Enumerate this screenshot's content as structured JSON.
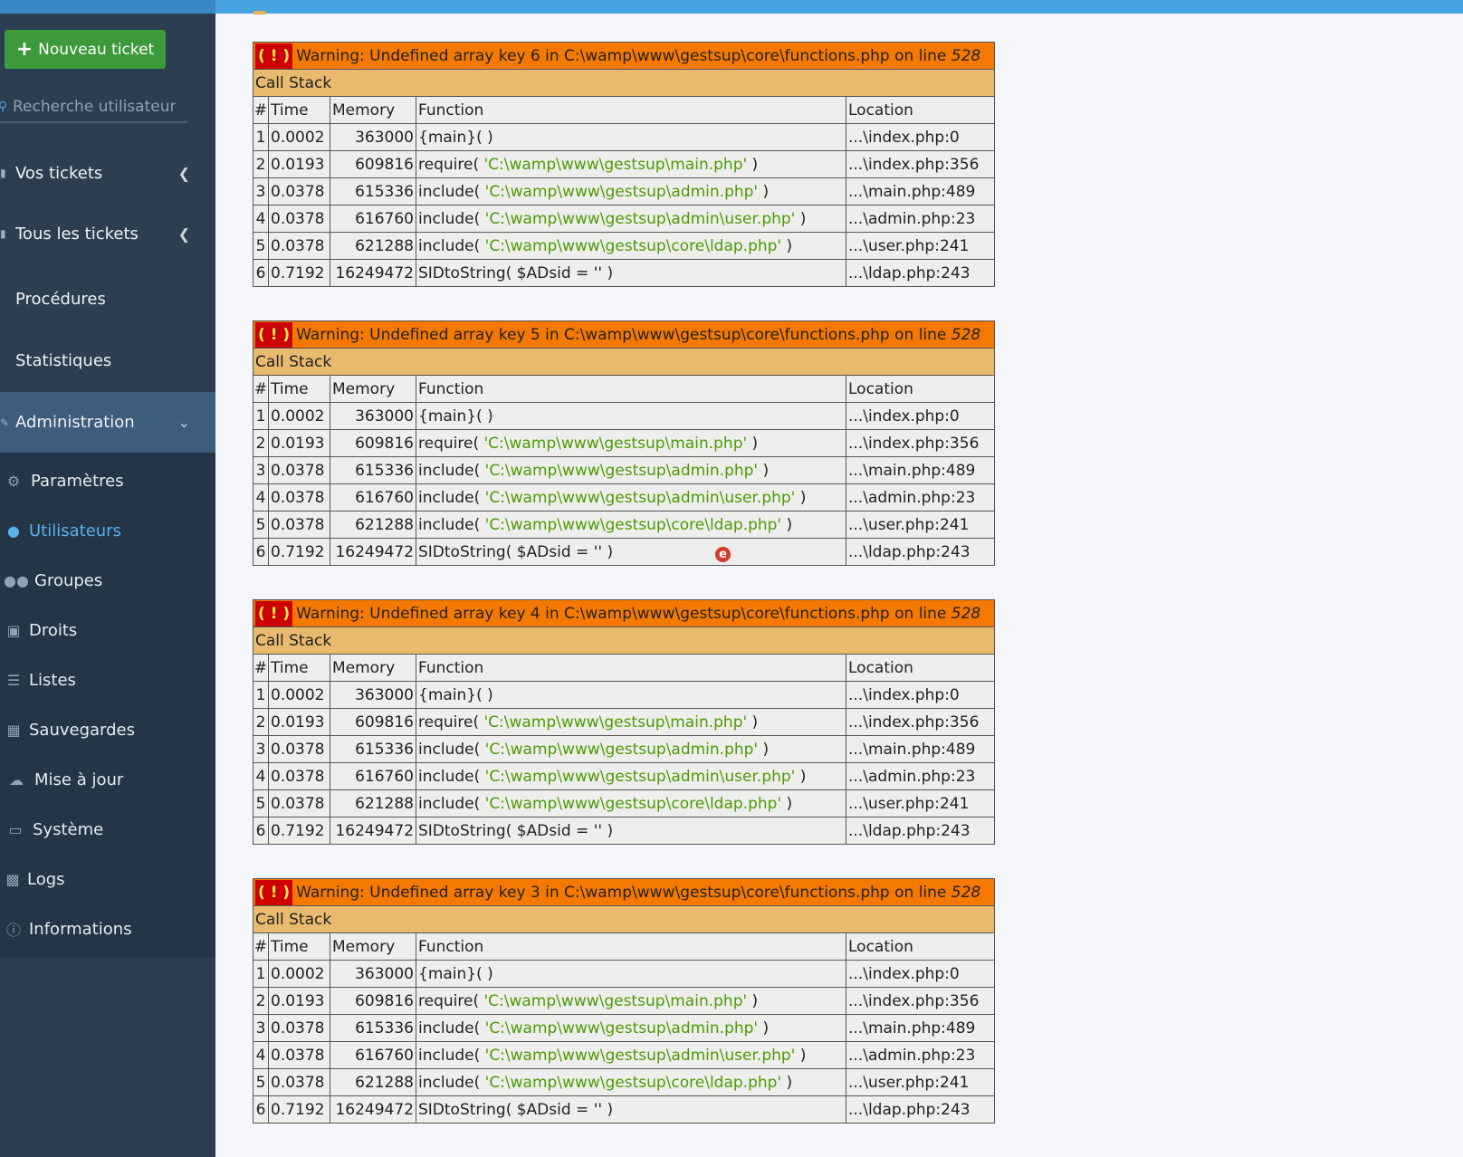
{
  "sidebar": {
    "new_ticket_label": "Nouveau ticket",
    "search_placeholder": "Recherche utilisateur",
    "nav": [
      {
        "label": "Vos tickets"
      },
      {
        "label": "Tous les tickets"
      },
      {
        "label": "Procédures"
      },
      {
        "label": "Statistiques"
      },
      {
        "label": "Administration"
      }
    ],
    "admin_items": [
      {
        "label": "Paramètres",
        "icon": "gear-icon"
      },
      {
        "label": "Utilisateurs",
        "icon": "user-icon"
      },
      {
        "label": "Groupes",
        "icon": "users-icon"
      },
      {
        "label": "Droits",
        "icon": "lock-icon"
      },
      {
        "label": "Listes",
        "icon": "list-icon"
      },
      {
        "label": "Sauvegardes",
        "icon": "save-icon"
      },
      {
        "label": "Mise à jour",
        "icon": "cloud-upload-icon"
      },
      {
        "label": "Système",
        "icon": "monitor-icon"
      },
      {
        "label": "Logs",
        "icon": "clipboard-icon"
      },
      {
        "label": "Informations",
        "icon": "info-icon"
      }
    ]
  },
  "colors": {
    "warning_bg": "#f57900",
    "callstack_bg": "#e9b96e",
    "string_color": "#4e9a06",
    "sidebar_bg": "#2c3e50",
    "active_nav": "#3d5d7c",
    "current_item": "#5ab0ea"
  },
  "warnings": [
    {
      "message": "Warning: Undefined array key 6 in C:\\wamp\\www\\gestsup\\core\\functions.php on line ",
      "line": "528",
      "callstack_label": "Call Stack",
      "headers": [
        "#",
        "Time",
        "Memory",
        "Function",
        "Location"
      ],
      "rows": [
        {
          "n": "1",
          "time": "0.0002",
          "memory": "363000",
          "fn": "{main}( )",
          "arg": "",
          "loc": "...\\index.php:0"
        },
        {
          "n": "2",
          "time": "0.0193",
          "memory": "609816",
          "fn": "require( ",
          "arg": "'C:\\wamp\\www\\gestsup\\main.php'",
          "loc": "...\\index.php:356"
        },
        {
          "n": "3",
          "time": "0.0378",
          "memory": "615336",
          "fn": "include( ",
          "arg": "'C:\\wamp\\www\\gestsup\\admin.php'",
          "loc": "...\\main.php:489"
        },
        {
          "n": "4",
          "time": "0.0378",
          "memory": "616760",
          "fn": "include( ",
          "arg": "'C:\\wamp\\www\\gestsup\\admin\\user.php'",
          "loc": "...\\admin.php:23"
        },
        {
          "n": "5",
          "time": "0.0378",
          "memory": "621288",
          "fn": "include( ",
          "arg": "'C:\\wamp\\www\\gestsup\\core\\ldap.php'",
          "loc": "...\\user.php:241"
        },
        {
          "n": "6",
          "time": "0.7192",
          "memory": "16249472",
          "fn": "SIDtoString( $ADsid = '' )",
          "arg": "",
          "loc": "...\\ldap.php:243"
        }
      ]
    },
    {
      "message": "Warning: Undefined array key 5 in C:\\wamp\\www\\gestsup\\core\\functions.php on line ",
      "line": "528",
      "callstack_label": "Call Stack",
      "headers": [
        "#",
        "Time",
        "Memory",
        "Function",
        "Location"
      ],
      "rows": [
        {
          "n": "1",
          "time": "0.0002",
          "memory": "363000",
          "fn": "{main}( )",
          "arg": "",
          "loc": "...\\index.php:0"
        },
        {
          "n": "2",
          "time": "0.0193",
          "memory": "609816",
          "fn": "require( ",
          "arg": "'C:\\wamp\\www\\gestsup\\main.php'",
          "loc": "...\\index.php:356"
        },
        {
          "n": "3",
          "time": "0.0378",
          "memory": "615336",
          "fn": "include( ",
          "arg": "'C:\\wamp\\www\\gestsup\\admin.php'",
          "loc": "...\\main.php:489"
        },
        {
          "n": "4",
          "time": "0.0378",
          "memory": "616760",
          "fn": "include( ",
          "arg": "'C:\\wamp\\www\\gestsup\\admin\\user.php'",
          "loc": "...\\admin.php:23"
        },
        {
          "n": "5",
          "time": "0.0378",
          "memory": "621288",
          "fn": "include( ",
          "arg": "'C:\\wamp\\www\\gestsup\\core\\ldap.php'",
          "loc": "...\\user.php:241"
        },
        {
          "n": "6",
          "time": "0.7192",
          "memory": "16249472",
          "fn": "SIDtoString( $ADsid = '' )",
          "arg": "",
          "loc": "...\\ldap.php:243"
        }
      ]
    },
    {
      "message": "Warning: Undefined array key 4 in C:\\wamp\\www\\gestsup\\core\\functions.php on line ",
      "line": "528",
      "callstack_label": "Call Stack",
      "headers": [
        "#",
        "Time",
        "Memory",
        "Function",
        "Location"
      ],
      "rows": [
        {
          "n": "1",
          "time": "0.0002",
          "memory": "363000",
          "fn": "{main}( )",
          "arg": "",
          "loc": "...\\index.php:0"
        },
        {
          "n": "2",
          "time": "0.0193",
          "memory": "609816",
          "fn": "require( ",
          "arg": "'C:\\wamp\\www\\gestsup\\main.php'",
          "loc": "...\\index.php:356"
        },
        {
          "n": "3",
          "time": "0.0378",
          "memory": "615336",
          "fn": "include( ",
          "arg": "'C:\\wamp\\www\\gestsup\\admin.php'",
          "loc": "...\\main.php:489"
        },
        {
          "n": "4",
          "time": "0.0378",
          "memory": "616760",
          "fn": "include( ",
          "arg": "'C:\\wamp\\www\\gestsup\\admin\\user.php'",
          "loc": "...\\admin.php:23"
        },
        {
          "n": "5",
          "time": "0.0378",
          "memory": "621288",
          "fn": "include( ",
          "arg": "'C:\\wamp\\www\\gestsup\\core\\ldap.php'",
          "loc": "...\\user.php:241"
        },
        {
          "n": "6",
          "time": "0.7192",
          "memory": "16249472",
          "fn": "SIDtoString( $ADsid = '' )",
          "arg": "",
          "loc": "...\\ldap.php:243"
        }
      ]
    },
    {
      "message": "Warning: Undefined array key 3 in C:\\wamp\\www\\gestsup\\core\\functions.php on line ",
      "line": "528",
      "callstack_label": "Call Stack",
      "headers": [
        "#",
        "Time",
        "Memory",
        "Function",
        "Location"
      ],
      "rows": [
        {
          "n": "1",
          "time": "0.0002",
          "memory": "363000",
          "fn": "{main}( )",
          "arg": "",
          "loc": "...\\index.php:0"
        },
        {
          "n": "2",
          "time": "0.0193",
          "memory": "609816",
          "fn": "require( ",
          "arg": "'C:\\wamp\\www\\gestsup\\main.php'",
          "loc": "...\\index.php:356"
        },
        {
          "n": "3",
          "time": "0.0378",
          "memory": "615336",
          "fn": "include( ",
          "arg": "'C:\\wamp\\www\\gestsup\\admin.php'",
          "loc": "...\\main.php:489"
        },
        {
          "n": "4",
          "time": "0.0378",
          "memory": "616760",
          "fn": "include( ",
          "arg": "'C:\\wamp\\www\\gestsup\\admin\\user.php'",
          "loc": "...\\admin.php:23"
        },
        {
          "n": "5",
          "time": "0.0378",
          "memory": "621288",
          "fn": "include( ",
          "arg": "'C:\\wamp\\www\\gestsup\\core\\ldap.php'",
          "loc": "...\\user.php:241"
        },
        {
          "n": "6",
          "time": "0.7192",
          "memory": "16249472",
          "fn": "SIDtoString( $ADsid = '' )",
          "arg": "",
          "loc": "...\\ldap.php:243"
        }
      ]
    }
  ],
  "overlay_badge": "e"
}
